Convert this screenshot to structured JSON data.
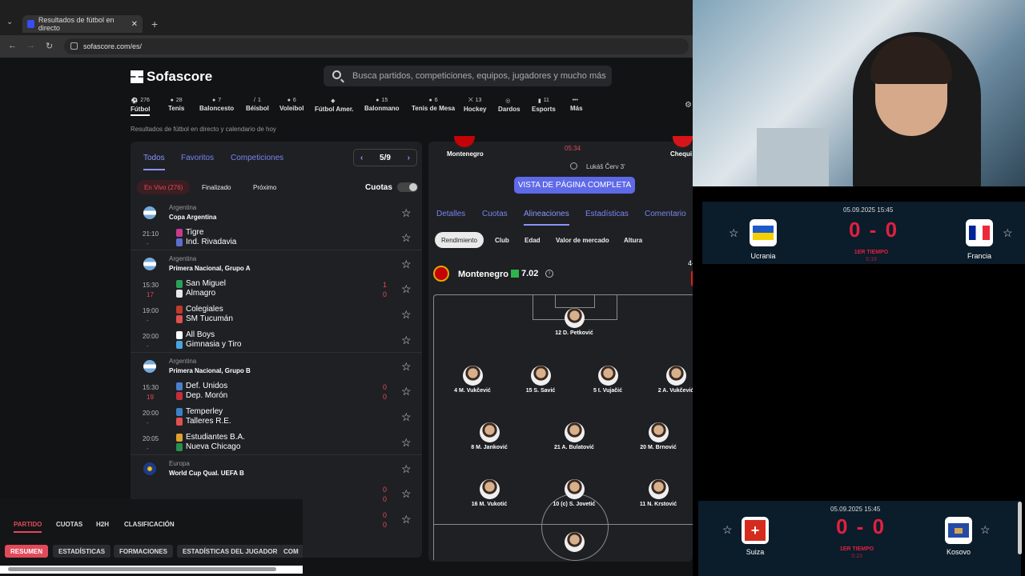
{
  "browser": {
    "tab_title": "Resultados de fútbol en directo",
    "url": "sofascore.com/es/"
  },
  "site": {
    "logo": "Sofascore",
    "search_placeholder": "Busca partidos, competiciones, equipos, jugadores y mucho más",
    "subtitle": "Resultados de fútbol en directo y calendario de hoy",
    "sports": [
      {
        "label": "Fútbol",
        "count": "276",
        "icon": "football-icon"
      },
      {
        "label": "Tenis",
        "count": "28",
        "icon": "tennis-icon"
      },
      {
        "label": "Baloncesto",
        "count": "7",
        "icon": "basketball-icon"
      },
      {
        "label": "Béisbol",
        "count": "1",
        "icon": "baseball-icon"
      },
      {
        "label": "Voleibol",
        "count": "6",
        "icon": "volleyball-icon"
      },
      {
        "label": "Fútbol Amer.",
        "count": "",
        "icon": "american-football-icon"
      },
      {
        "label": "Balonmano",
        "count": "15",
        "icon": "handball-icon"
      },
      {
        "label": "Tenis de Mesa",
        "count": "6",
        "icon": "table-tennis-icon"
      },
      {
        "label": "Hockey",
        "count": "13",
        "icon": "hockey-icon"
      },
      {
        "label": "Dardos",
        "count": "",
        "icon": "darts-icon"
      },
      {
        "label": "Esports",
        "count": "11",
        "icon": "esports-icon"
      },
      {
        "label": "Más",
        "count": "",
        "icon": "more-icon"
      }
    ]
  },
  "left": {
    "tabs": [
      "Todos",
      "Favoritos",
      "Competiciones"
    ],
    "pager": "5/9",
    "chips": [
      "En Vivo (276)",
      "Finalizado",
      "Próximo"
    ],
    "odds_label": "Cuotas",
    "leagues": [
      {
        "country": "Argentina",
        "name": "Copa Argentina",
        "matches": [
          {
            "time": "21:10",
            "status": "-",
            "home": "Tigre",
            "away": "Ind. Rivadavia",
            "hs": "",
            "as": ""
          }
        ]
      },
      {
        "country": "Argentina",
        "name": "Primera Nacional, Grupo A",
        "matches": [
          {
            "time": "15:30",
            "status": "17",
            "home": "San Miguel",
            "away": "Almagro",
            "hs": "1",
            "as": "0"
          },
          {
            "time": "19:00",
            "status": "-",
            "home": "Colegiales",
            "away": "SM Tucumán",
            "hs": "",
            "as": ""
          },
          {
            "time": "20:00",
            "status": "-",
            "home": "All Boys",
            "away": "Gimnasia y Tiro",
            "hs": "",
            "as": ""
          }
        ]
      },
      {
        "country": "Argentina",
        "name": "Primera Nacional, Grupo B",
        "matches": [
          {
            "time": "15:30",
            "status": "19",
            "home": "Def. Unidos",
            "away": "Dep. Morón",
            "hs": "0",
            "as": "0"
          },
          {
            "time": "20:00",
            "status": "-",
            "home": "Temperley",
            "away": "Talleres R.E.",
            "hs": "",
            "as": ""
          },
          {
            "time": "20:05",
            "status": "-",
            "home": "Estudiantes B.A.",
            "away": "Nueva Chicago",
            "hs": "",
            "as": ""
          }
        ]
      },
      {
        "country": "Europa",
        "name": "World Cup Qual. UEFA B",
        "matches": []
      }
    ],
    "extra_scores": [
      [
        "0",
        "0"
      ],
      [
        "0",
        "0"
      ]
    ]
  },
  "bottom": {
    "tabs": [
      "PARTIDO",
      "CUOTAS",
      "H2H",
      "CLASIFICACIÓN"
    ],
    "chips": [
      "RESUMEN",
      "ESTADÍSTICAS",
      "FORMACIONES",
      "ESTADÍSTICAS DEL JUGADOR",
      "COM"
    ]
  },
  "center": {
    "home": "Montenegro",
    "away": "Chequi",
    "time": "05:34",
    "referee": "Lukáš Červ 3'",
    "full_view": "VISTA DE PÁGINA COMPLETA",
    "tabs": [
      "Detalles",
      "Cuotas",
      "Alineaciones",
      "Estadísticas",
      "Comentario"
    ],
    "chips": [
      "Rendimiento",
      "Club",
      "Edad",
      "Valor de mercado",
      "Altura"
    ],
    "team_name": "Montenegro",
    "team_rating": "7.02",
    "formation": "4-3-3",
    "players": [
      {
        "label": "12 D. Petković"
      },
      {
        "label": "4 M. Vukčević"
      },
      {
        "label": "15 S. Savić"
      },
      {
        "label": "5 I. Vujačić"
      },
      {
        "label": "2 A. Vukčević"
      },
      {
        "label": "8 M. Janković"
      },
      {
        "label": "21 A. Bulatović"
      },
      {
        "label": "20 M. Brnović"
      },
      {
        "label": "16 M. Vukotić"
      },
      {
        "label": "10 (c) S. Jovetić"
      },
      {
        "label": "11 N. Krstović"
      }
    ]
  },
  "score1": {
    "date": "05.09.2025 15:45",
    "home": "Ucrania",
    "away": "Francia",
    "score": "0 - 0",
    "period": "1ER TIEMPO",
    "minute": "5:16"
  },
  "score2": {
    "date": "05.09.2025 15:45",
    "home": "Suiza",
    "away": "Kosovo",
    "score": "0 - 0",
    "period": "1ER TIEMPO",
    "minute": "3:23"
  }
}
